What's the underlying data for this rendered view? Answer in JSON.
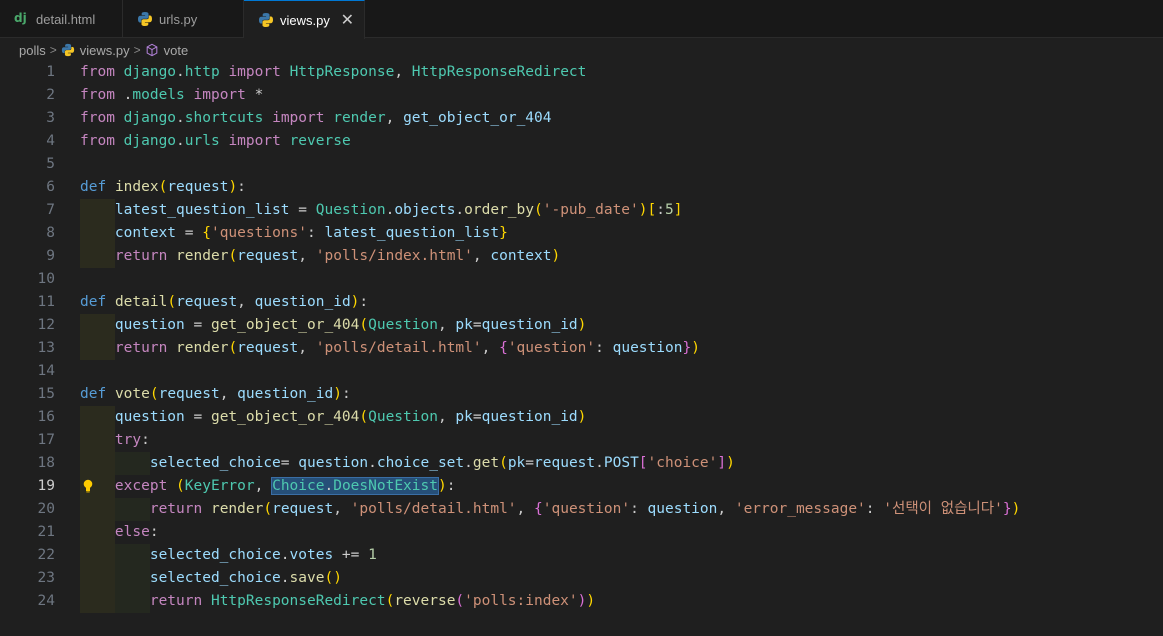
{
  "tabs": [
    {
      "label": "detail.html",
      "icon": "django-icon",
      "active": false
    },
    {
      "label": "urls.py",
      "icon": "python-icon",
      "active": false
    },
    {
      "label": "views.py",
      "icon": "python-icon",
      "active": true
    }
  ],
  "tab_icon_django_text": "dj",
  "close_glyph": "✕",
  "breadcrumb": {
    "folder": "polls",
    "file": "views.py",
    "symbol": "vote"
  },
  "current_line": 19,
  "lines": [
    {
      "n": "1",
      "t": "from django.http import HttpResponse, HttpResponseRedirect"
    },
    {
      "n": "2",
      "t": "from .models import *"
    },
    {
      "n": "3",
      "t": "from django.shortcuts import render, get_object_or_404"
    },
    {
      "n": "4",
      "t": "from django.urls import reverse"
    },
    {
      "n": "5",
      "t": ""
    },
    {
      "n": "6",
      "t": "def index(request):"
    },
    {
      "n": "7",
      "t": "    latest_question_list = Question.objects.order_by('-pub_date')[:5]"
    },
    {
      "n": "8",
      "t": "    context = {'questions': latest_question_list}"
    },
    {
      "n": "9",
      "t": "    return render(request, 'polls/index.html', context)"
    },
    {
      "n": "10",
      "t": ""
    },
    {
      "n": "11",
      "t": "def detail(request, question_id):"
    },
    {
      "n": "12",
      "t": "    question = get_object_or_404(Question, pk=question_id)"
    },
    {
      "n": "13",
      "t": "    return render(request, 'polls/detail.html', {'question': question})"
    },
    {
      "n": "14",
      "t": ""
    },
    {
      "n": "15",
      "t": "def vote(request, question_id):"
    },
    {
      "n": "16",
      "t": "    question = get_object_or_404(Question, pk=question_id)"
    },
    {
      "n": "17",
      "t": "    try:"
    },
    {
      "n": "18",
      "t": "        selected_choice= question.choice_set.get(pk=request.POST['choice'])"
    },
    {
      "n": "19",
      "t": "    except (KeyError, Choice.DoesNotExist):"
    },
    {
      "n": "20",
      "t": "        return render(request, 'polls/detail.html', {'question': question, 'error_message': '선택이 없습니다'})"
    },
    {
      "n": "21",
      "t": "    else:"
    },
    {
      "n": "22",
      "t": "        selected_choice.votes += 1"
    },
    {
      "n": "23",
      "t": "        selected_choice.save()"
    },
    {
      "n": "24",
      "t": "        return HttpResponseRedirect(reverse('polls:index'))"
    }
  ]
}
